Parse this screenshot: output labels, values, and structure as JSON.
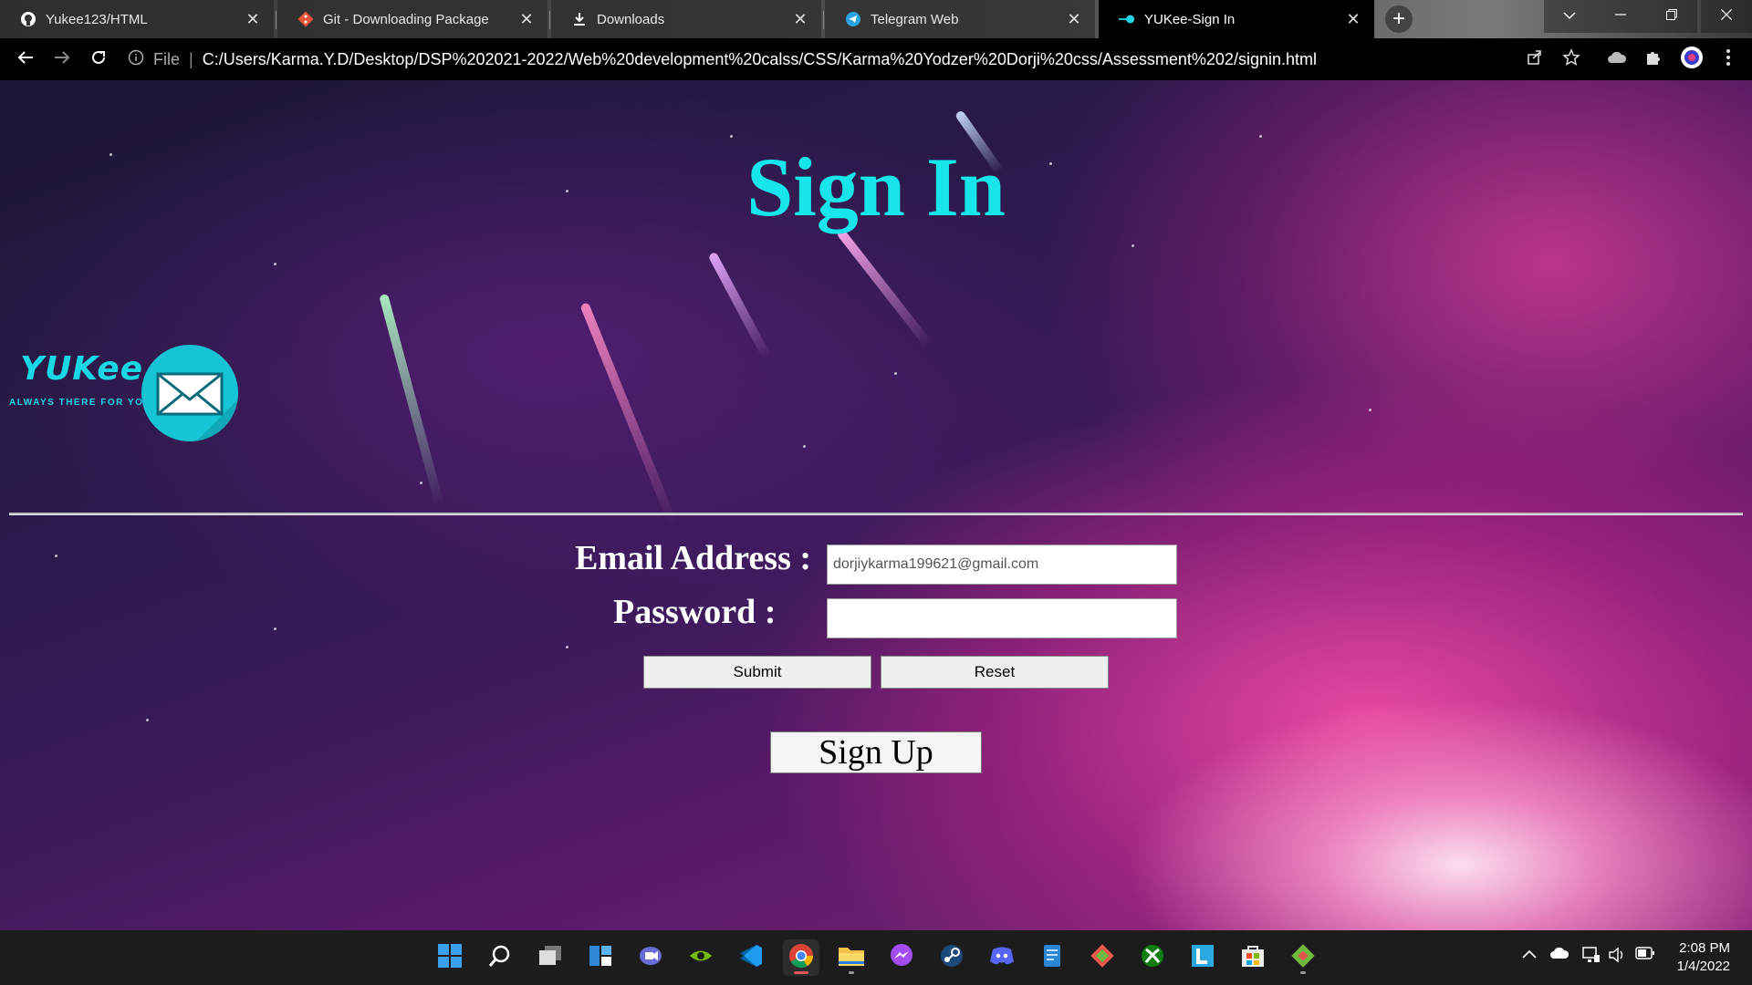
{
  "browser": {
    "tabs": [
      {
        "title": "Yukee123/HTML",
        "icon": "github-icon"
      },
      {
        "title": "Git - Downloading Package",
        "icon": "git-icon"
      },
      {
        "title": "Downloads",
        "icon": "download-icon"
      },
      {
        "title": "Telegram Web",
        "icon": "telegram-icon"
      },
      {
        "title": "YUKee-Sign In",
        "icon": "yukee-favicon"
      }
    ],
    "active_tab": 4,
    "close_glyph": "✕",
    "new_tab_glyph": "+",
    "address": {
      "scheme_label": "File",
      "url": "C:/Users/Karma.Y.D/Desktop/DSP%202021-2022/Web%20development%20calss/CSS/Karma%20Yodzer%20Dorji%20css/Assessment%202/signin.html"
    }
  },
  "page": {
    "title": "Sign In",
    "logo": {
      "wordmark": "YUKee",
      "tagline": "ALWAYS THERE FOR YOU"
    },
    "form": {
      "email_label": "Email Address :",
      "email_value": "dorjiykarma199621@gmail.com",
      "password_label": "Password :",
      "password_value": "",
      "submit_label": "Submit",
      "reset_label": "Reset"
    },
    "signup_label": "Sign Up"
  },
  "taskbar": {
    "apps": [
      "start-icon",
      "search-icon",
      "task-view-icon",
      "widgets-icon",
      "teams-chat-icon",
      "nvidia-icon",
      "vscode-icon",
      "chrome-icon",
      "file-explorer-icon",
      "messenger-icon",
      "steam-icon",
      "discord-icon",
      "notepad-icon",
      "sourcetree-icon",
      "xbox-icon",
      "lingo-icon",
      "microsoft-store-icon",
      "git-gui-icon"
    ],
    "clock": {
      "time": "2:08 PM",
      "date": "1/4/2022"
    }
  },
  "colors": {
    "title": "#16e6ea",
    "logo": "#18d8e4",
    "page_text": "#ffffff"
  }
}
